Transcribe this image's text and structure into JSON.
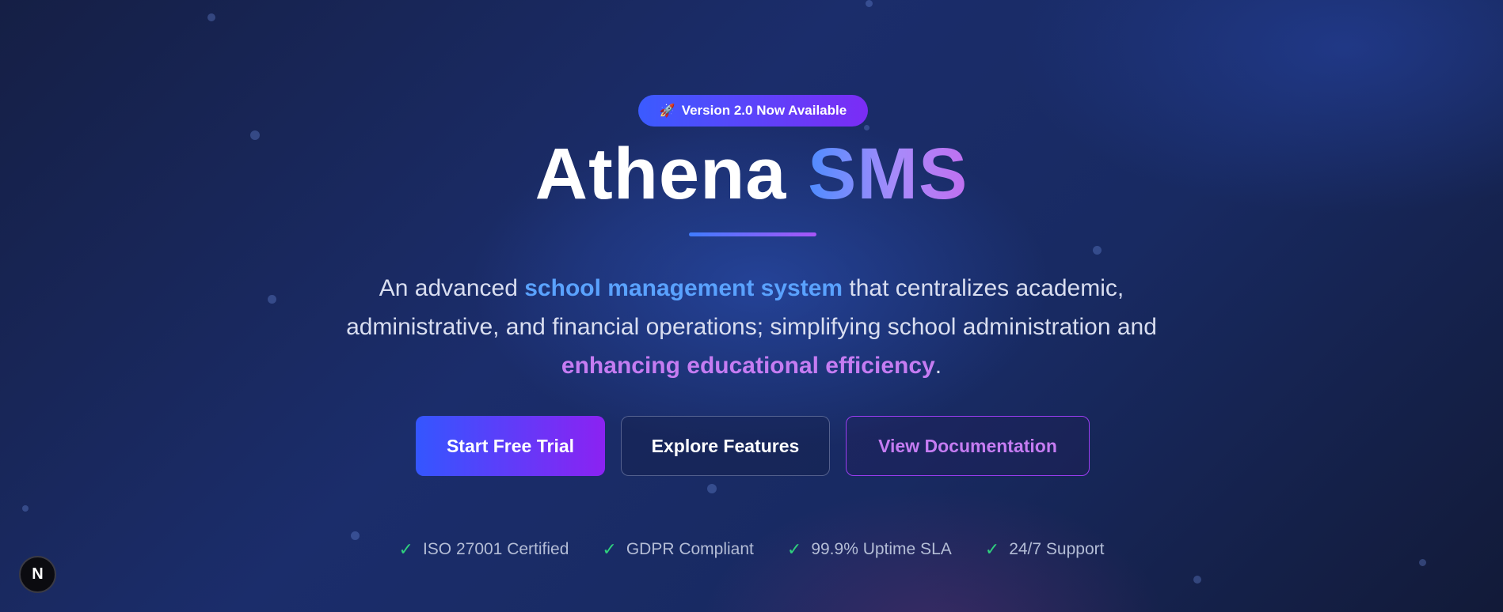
{
  "badge": {
    "icon": "rocket-icon",
    "label": "Version 2.0 Now Available"
  },
  "hero": {
    "title_main": "Athena",
    "title_accent": "SMS",
    "description": {
      "part1": "An advanced ",
      "highlight1": "school management system",
      "part2": " that centralizes academic, administrative, and financial operations; simplifying school administration and ",
      "highlight2": "enhancing educational efficiency",
      "part3": "."
    }
  },
  "actions": {
    "primary": "Start Free Trial",
    "secondary": "Explore Features",
    "outline": "View Documentation"
  },
  "trust_badges": [
    {
      "icon": "check-icon",
      "label": "ISO 27001 Certified"
    },
    {
      "icon": "check-icon",
      "label": "GDPR Compliant"
    },
    {
      "icon": "check-icon",
      "label": "99.9% Uptime SLA"
    },
    {
      "icon": "check-icon",
      "label": "24/7 Support"
    }
  ],
  "dev_badge": {
    "label": "N"
  },
  "colors": {
    "accent_blue": "#5aa2ff",
    "accent_purple": "#c57cf2",
    "success": "#2fd07d"
  }
}
